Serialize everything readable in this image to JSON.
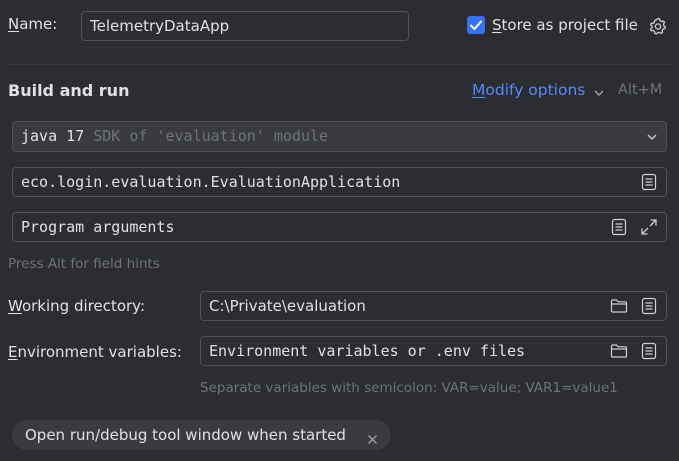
{
  "name": {
    "label": "Name:",
    "label_mnemonic": "N",
    "label_rest": "ame:",
    "value": "TelemetryDataApp"
  },
  "store": {
    "checked": true,
    "label_mnemonic": "S",
    "label_rest": "tore as project file",
    "icon": "gear-icon"
  },
  "build": {
    "heading": "Build and run",
    "modify_mnemonic": "M",
    "modify_rest": "odify options",
    "shortcut": "Alt+M"
  },
  "sdk": {
    "value_main": "java 17",
    "value_detail": "SDK of 'evaluation' module"
  },
  "main_class": {
    "value": "eco.login.evaluation.EvaluationApplication"
  },
  "program_args": {
    "placeholder": "Program arguments"
  },
  "field_hint": "Press Alt for field hints",
  "working_dir": {
    "label_mnemonic": "W",
    "label_rest": "orking directory:",
    "value": "C:\\Private\\evaluation"
  },
  "env_vars": {
    "label_mnemonic": "E",
    "label_rest": "nvironment variables:",
    "placeholder": "Environment variables or .env files",
    "hint": "Separate variables with semicolon: VAR=value; VAR1=value1"
  },
  "tag": {
    "label": "Open run/debug tool window when started"
  },
  "colors": {
    "background": "#2b2d30",
    "accent": "#3574f0",
    "link": "#548af7",
    "border": "#4e5157"
  }
}
